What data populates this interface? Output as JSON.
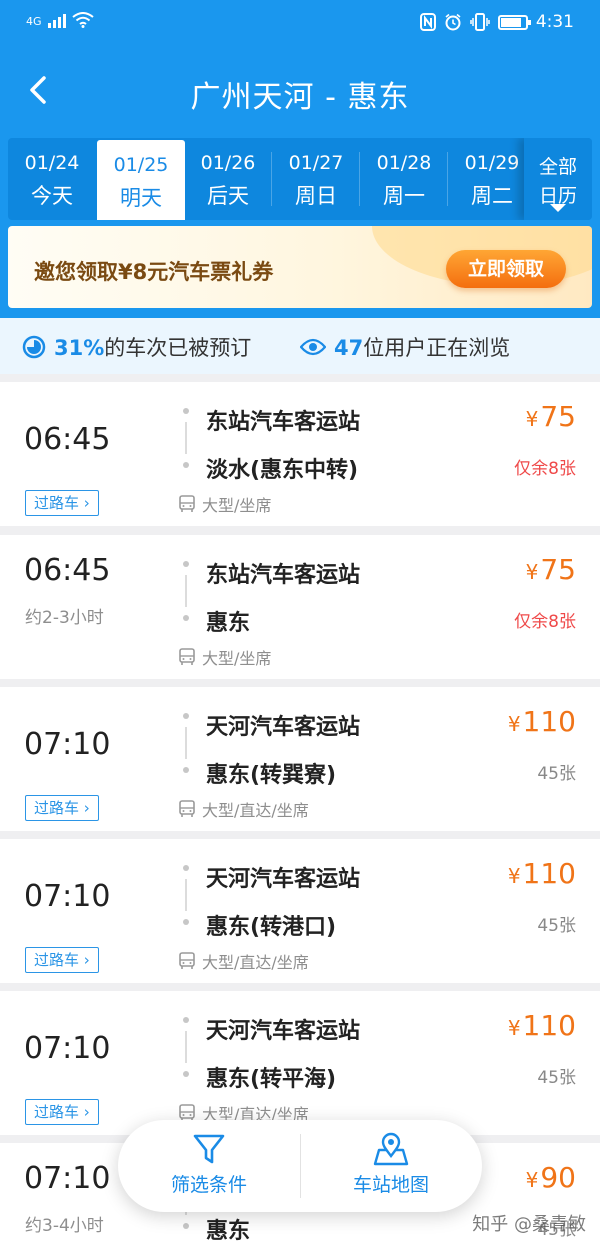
{
  "status_bar": {
    "network": "4G",
    "time": "4:31"
  },
  "nav": {
    "title": "广州天河 - 惠东"
  },
  "dates": [
    {
      "date": "01/24",
      "weekday": "今天",
      "active": false
    },
    {
      "date": "01/25",
      "weekday": "明天",
      "active": true
    },
    {
      "date": "01/26",
      "weekday": "后天",
      "active": false
    },
    {
      "date": "01/27",
      "weekday": "周日",
      "active": false
    },
    {
      "date": "01/28",
      "weekday": "周一",
      "active": false
    },
    {
      "date": "01/29",
      "weekday": "周二",
      "active": false
    }
  ],
  "calendar_button": {
    "line1": "全部",
    "line2": "日历"
  },
  "promo": {
    "text": "邀您领取¥8元汽车票礼券",
    "button": "立即领取"
  },
  "stats": {
    "booked_percent": "31%",
    "booked_text": "的车次已被预订",
    "viewers": "47",
    "viewers_text": "位用户正在浏览"
  },
  "trips": [
    {
      "time": "06:45",
      "tag": "过路车",
      "duration": "",
      "from": "东站汽车客运站",
      "to": "淡水(惠东中转)",
      "type": "大型/坐席",
      "currency": "¥",
      "price": "75",
      "seats": "仅余8张",
      "low": true
    },
    {
      "time": "06:45",
      "tag": "",
      "duration": "约2-3小时",
      "from": "东站汽车客运站",
      "to": "惠东",
      "type": "大型/坐席",
      "currency": "¥",
      "price": "75",
      "seats": "仅余8张",
      "low": true
    },
    {
      "time": "07:10",
      "tag": "过路车",
      "duration": "",
      "from": "天河汽车客运站",
      "to": "惠东(转巽寮)",
      "type": "大型/直达/坐席",
      "currency": "¥",
      "price": "110",
      "seats": "45张",
      "low": false
    },
    {
      "time": "07:10",
      "tag": "过路车",
      "duration": "",
      "from": "天河汽车客运站",
      "to": "惠东(转港口)",
      "type": "大型/直达/坐席",
      "currency": "¥",
      "price": "110",
      "seats": "45张",
      "low": false
    },
    {
      "time": "07:10",
      "tag": "过路车",
      "duration": "",
      "from": "天河汽车客运站",
      "to": "惠东(转平海)",
      "type": "大型/直达/坐席",
      "currency": "¥",
      "price": "110",
      "seats": "45张",
      "low": false
    },
    {
      "time": "07:10",
      "tag": "",
      "duration": "约3-4小时",
      "from": "",
      "to": "惠东",
      "type": "",
      "currency": "¥",
      "price": "90",
      "seats": "45张",
      "low": false
    }
  ],
  "float_bar": {
    "filter": "筛选条件",
    "map": "车站地图"
  },
  "watermark": "知乎 @桑青敏",
  "colors": {
    "primary": "#1a97ee",
    "price": "#f07418",
    "low_stock": "#ef4a4a"
  }
}
